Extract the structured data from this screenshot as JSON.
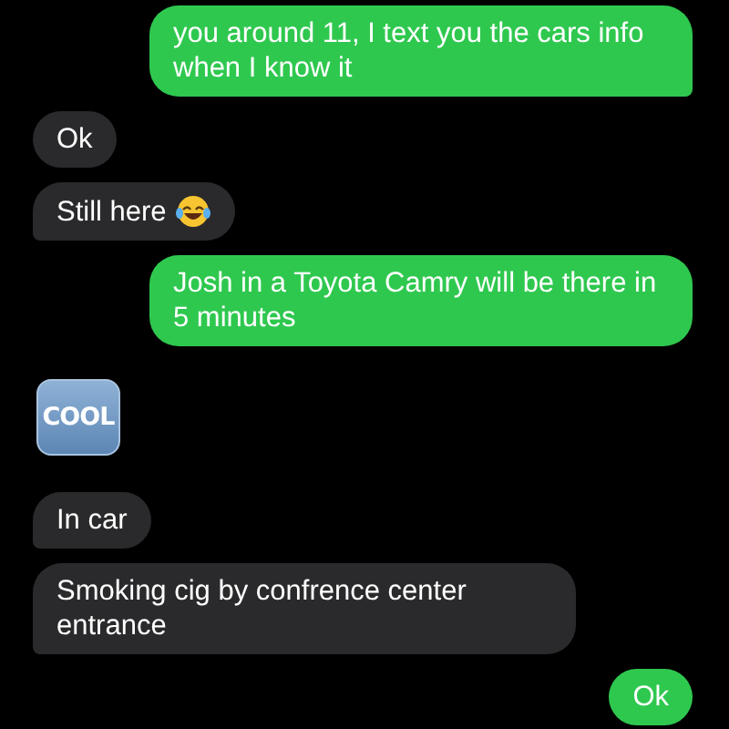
{
  "messages": [
    {
      "kind": "sent",
      "text": "you around 11, I text you the cars info when I know it",
      "tail": true
    },
    {
      "kind": "received",
      "text": "Ok",
      "tail": false
    },
    {
      "kind": "received",
      "text": "Still here",
      "emoji": true,
      "tail": true
    },
    {
      "kind": "sent",
      "text": "Josh in a Toyota Camry will be there in 5 minutes",
      "tail": false
    },
    {
      "kind": "sticker",
      "text": "COOL"
    },
    {
      "kind": "received",
      "text": "In car",
      "tail": true
    },
    {
      "kind": "received",
      "text": "Smoking cig by confrence center entrance",
      "tail": true
    },
    {
      "kind": "sent",
      "text": "Ok",
      "tail": false
    }
  ]
}
